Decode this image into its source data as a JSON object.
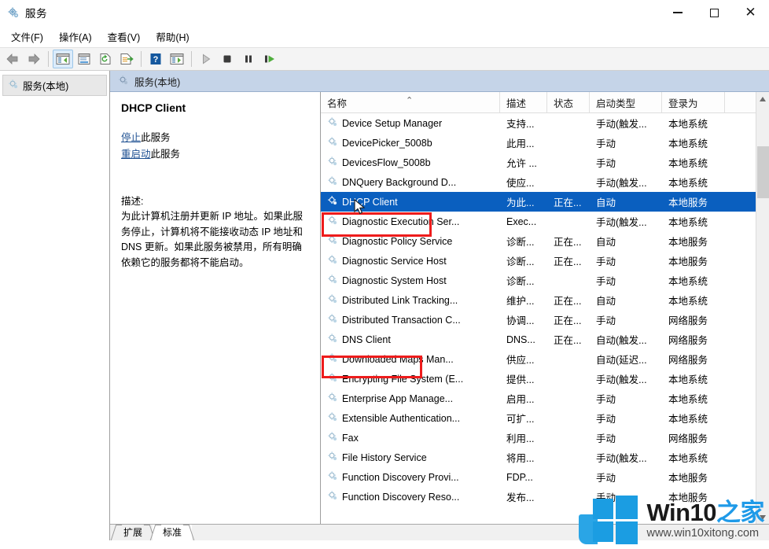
{
  "window": {
    "title": "服务",
    "icon": "services-gear-icon",
    "minimize_label": "最小化",
    "maximize_label": "最大化",
    "close_label": "关闭"
  },
  "menubar": {
    "items": [
      {
        "label": "文件(F)",
        "name": "menu-file"
      },
      {
        "label": "操作(A)",
        "name": "menu-action"
      },
      {
        "label": "查看(V)",
        "name": "menu-view"
      },
      {
        "label": "帮助(H)",
        "name": "menu-help"
      }
    ]
  },
  "toolbar": {
    "buttons": [
      {
        "name": "back-button",
        "icon": "arrow-left-icon"
      },
      {
        "name": "forward-button",
        "icon": "arrow-right-icon"
      },
      {
        "name": "show-hide-tree-button",
        "icon": "show-tree-icon",
        "active": true
      },
      {
        "name": "properties-button",
        "icon": "properties-icon"
      },
      {
        "name": "refresh-button",
        "icon": "refresh-icon"
      },
      {
        "name": "export-list-button",
        "icon": "export-list-icon"
      },
      {
        "name": "help-button",
        "icon": "question-mark-icon"
      },
      {
        "name": "show-action-pane-button",
        "icon": "action-pane-icon"
      },
      {
        "name": "start-service-button",
        "icon": "play-icon"
      },
      {
        "name": "stop-service-button",
        "icon": "stop-icon"
      },
      {
        "name": "pause-service-button",
        "icon": "pause-icon"
      },
      {
        "name": "restart-service-button",
        "icon": "restart-icon"
      }
    ]
  },
  "tree": {
    "root_label": "服务(本地)",
    "root_icon": "services-gear-icon"
  },
  "pane": {
    "header_label": "服务(本地)",
    "header_icon": "services-gear-icon"
  },
  "details": {
    "service_name": "DHCP Client",
    "links": [
      {
        "link_text": "停止",
        "suffix": "此服务",
        "name": "stop-this-service-link"
      },
      {
        "link_text": "重启动",
        "suffix": "此服务",
        "name": "restart-this-service-link"
      }
    ],
    "description_label": "描述:",
    "description_text": "为此计算机注册并更新 IP 地址。如果此服务停止，计算机将不能接收动态 IP 地址和 DNS 更新。如果此服务被禁用，所有明确依赖它的服务都将不能启动。"
  },
  "list": {
    "columns": [
      {
        "label": "名称",
        "name": "column-name",
        "sorted": true,
        "sort_icon": "chevron-up-icon"
      },
      {
        "label": "描述",
        "name": "column-description"
      },
      {
        "label": "状态",
        "name": "column-status"
      },
      {
        "label": "启动类型",
        "name": "column-startup-type"
      },
      {
        "label": "登录为",
        "name": "column-log-on-as"
      }
    ],
    "rows": [
      {
        "name": "Device Setup Manager",
        "desc": "支持...",
        "state": "",
        "startup": "手动(触发...",
        "logon": "本地系统",
        "selected": false
      },
      {
        "name": "DevicePicker_5008b",
        "desc": "此用...",
        "state": "",
        "startup": "手动",
        "logon": "本地系统",
        "selected": false
      },
      {
        "name": "DevicesFlow_5008b",
        "desc": "允许 ...",
        "state": "",
        "startup": "手动",
        "logon": "本地系统",
        "selected": false
      },
      {
        "name": "DNQuery Background D...",
        "desc": "使应...",
        "state": "",
        "startup": "手动(触发...",
        "logon": "本地系统",
        "selected": false
      },
      {
        "name": "DHCP Client",
        "desc": "为此...",
        "state": "正在...",
        "startup": "自动",
        "logon": "本地服务",
        "selected": true
      },
      {
        "name": "Diagnostic Execution Ser...",
        "desc": "Exec...",
        "state": "",
        "startup": "手动(触发...",
        "logon": "本地系统",
        "selected": false
      },
      {
        "name": "Diagnostic Policy Service",
        "desc": "诊断...",
        "state": "正在...",
        "startup": "自动",
        "logon": "本地服务",
        "selected": false
      },
      {
        "name": "Diagnostic Service Host",
        "desc": "诊断...",
        "state": "正在...",
        "startup": "手动",
        "logon": "本地服务",
        "selected": false
      },
      {
        "name": "Diagnostic System Host",
        "desc": "诊断...",
        "state": "",
        "startup": "手动",
        "logon": "本地系统",
        "selected": false
      },
      {
        "name": "Distributed Link Tracking...",
        "desc": "维护...",
        "state": "正在...",
        "startup": "自动",
        "logon": "本地系统",
        "selected": false
      },
      {
        "name": "Distributed Transaction C...",
        "desc": "协调...",
        "state": "正在...",
        "startup": "手动",
        "logon": "网络服务",
        "selected": false
      },
      {
        "name": "DNS Client",
        "desc": "DNS...",
        "state": "正在...",
        "startup": "自动(触发...",
        "logon": "网络服务",
        "selected": false
      },
      {
        "name": "Downloaded Maps Man...",
        "desc": "供应...",
        "state": "",
        "startup": "自动(延迟...",
        "logon": "网络服务",
        "selected": false
      },
      {
        "name": "Encrypting File System (E...",
        "desc": "提供...",
        "state": "",
        "startup": "手动(触发...",
        "logon": "本地系统",
        "selected": false
      },
      {
        "name": "Enterprise App Manage...",
        "desc": "启用...",
        "state": "",
        "startup": "手动",
        "logon": "本地系统",
        "selected": false
      },
      {
        "name": "Extensible Authentication...",
        "desc": "可扩...",
        "state": "",
        "startup": "手动",
        "logon": "本地系统",
        "selected": false
      },
      {
        "name": "Fax",
        "desc": "利用...",
        "state": "",
        "startup": "手动",
        "logon": "网络服务",
        "selected": false
      },
      {
        "name": "File History Service",
        "desc": "将用...",
        "state": "",
        "startup": "手动(触发...",
        "logon": "本地系统",
        "selected": false
      },
      {
        "name": "Function Discovery Provi...",
        "desc": "FDP...",
        "state": "",
        "startup": "手动",
        "logon": "本地服务",
        "selected": false
      },
      {
        "name": "Function Discovery Reso...",
        "desc": "发布...",
        "state": "",
        "startup": "手动",
        "logon": "本地服务",
        "selected": false
      }
    ]
  },
  "tabs": [
    {
      "label": "扩展",
      "name": "tab-extended",
      "active": false
    },
    {
      "label": "标准",
      "name": "tab-standard",
      "active": true
    }
  ],
  "watermark": {
    "brand": "Win10",
    "brand_cn": "之家",
    "url": "www.win10xitong.com"
  },
  "colors": {
    "selection_blue": "#0a5fbf",
    "annotation_red": "#ee1c1c",
    "pane_header_blue": "#c5d4e8",
    "link_blue": "#1c4f91",
    "watermark_blue": "#1b9de2"
  }
}
